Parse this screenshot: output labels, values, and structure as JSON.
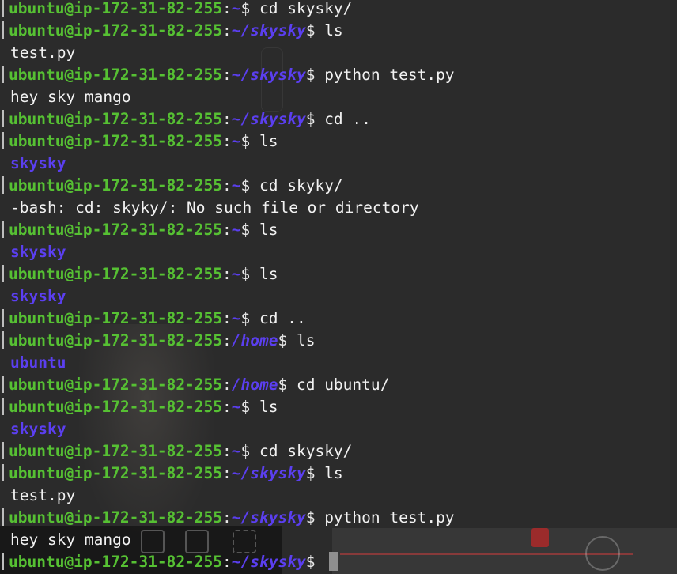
{
  "prompt": {
    "userhost": "ubuntu@ip-172-31-82-255"
  },
  "lines": [
    {
      "type": "prompt",
      "path": "~",
      "cmd": "cd skysky/"
    },
    {
      "type": "prompt",
      "path": "~/skysky",
      "cmd": "ls"
    },
    {
      "type": "output",
      "text": "test.py"
    },
    {
      "type": "prompt",
      "path": "~/skysky",
      "cmd": "python test.py"
    },
    {
      "type": "output",
      "text": "hey sky mango"
    },
    {
      "type": "prompt",
      "path": "~/skysky",
      "cmd": "cd .."
    },
    {
      "type": "prompt",
      "path": "~",
      "cmd": "ls"
    },
    {
      "type": "dir",
      "text": "skysky"
    },
    {
      "type": "prompt",
      "path": "~",
      "cmd": "cd skyky/"
    },
    {
      "type": "output",
      "text": "-bash: cd: skyky/: No such file or directory"
    },
    {
      "type": "prompt",
      "path": "~",
      "cmd": "ls"
    },
    {
      "type": "dir",
      "text": "skysky"
    },
    {
      "type": "prompt",
      "path": "~",
      "cmd": "ls"
    },
    {
      "type": "dir",
      "text": "skysky"
    },
    {
      "type": "prompt",
      "path": "~",
      "cmd": "cd .."
    },
    {
      "type": "prompt",
      "path": "/home",
      "cmd": "ls"
    },
    {
      "type": "dir",
      "text": "ubuntu"
    },
    {
      "type": "prompt",
      "path": "/home",
      "cmd": "cd ubuntu/"
    },
    {
      "type": "prompt",
      "path": "~",
      "cmd": "ls"
    },
    {
      "type": "dir",
      "text": "skysky"
    },
    {
      "type": "prompt",
      "path": "~",
      "cmd": "cd skysky/"
    },
    {
      "type": "prompt",
      "path": "~/skysky",
      "cmd": "ls"
    },
    {
      "type": "output",
      "text": "test.py"
    },
    {
      "type": "prompt",
      "path": "~/skysky",
      "cmd": "python test.py"
    },
    {
      "type": "output",
      "text": "hey sky mango"
    },
    {
      "type": "prompt",
      "path": "~/skysky",
      "cmd": ""
    }
  ],
  "colors": {
    "background": "#2b2b2b",
    "user_host": "#56c033",
    "path": "#5b3ff0",
    "directory": "#5b3ff0",
    "text": "#f2f2f2",
    "cursor": "#8f8f8f"
  }
}
